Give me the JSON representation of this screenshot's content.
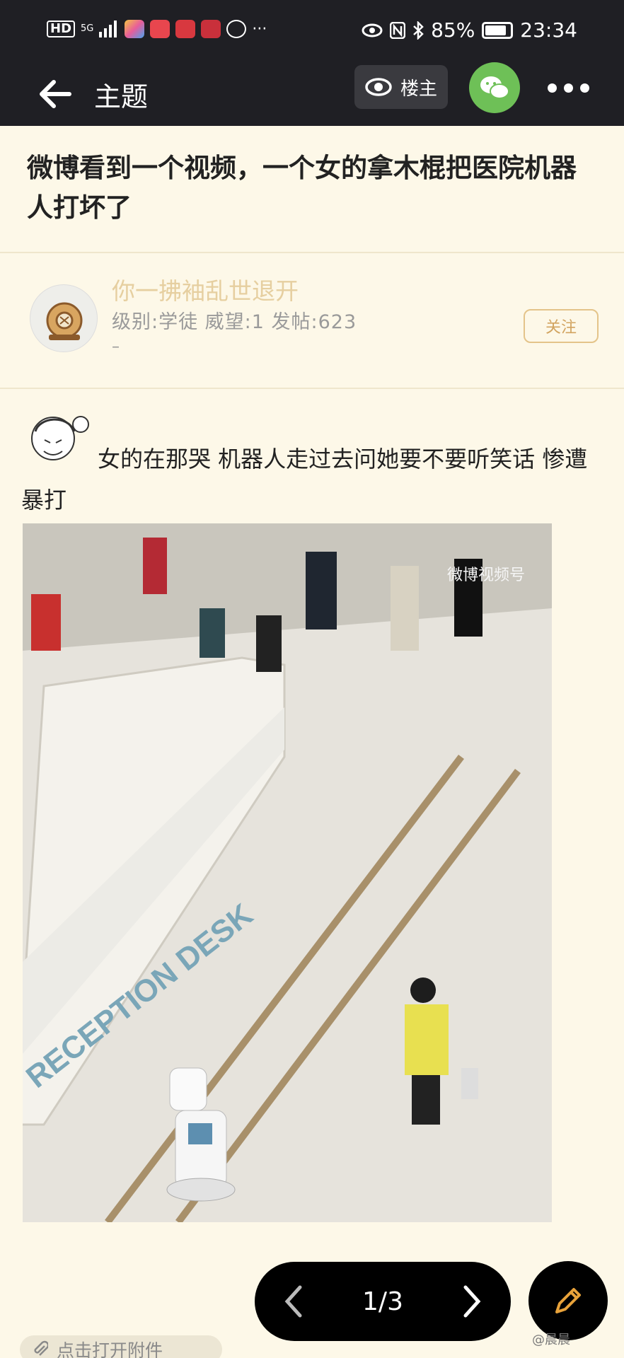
{
  "status_bar": {
    "hd": "HD",
    "network": "5G",
    "battery": "85%",
    "battery_level": 0.85,
    "time": "23:34",
    "dots": "···"
  },
  "nav": {
    "title": "主题",
    "owner_only": "楼主"
  },
  "post": {
    "title": "微博看到一个视频，一个女的拿木棍把医院机器人打坏了"
  },
  "author": {
    "name": "你一拂袖乱世退开",
    "meta": "级别:学徒 威望:1 发帖:623",
    "dash": "–",
    "follow_label": "关注"
  },
  "content": {
    "text": "女的在那哭 机器人走过去问她要不要听笑话 惨遭暴打",
    "image": {
      "desk_text": "RECEPTION DESK",
      "source": "微博视频号"
    }
  },
  "pager": {
    "current": "1/3"
  },
  "attachment": {
    "label": "点击打开附件"
  },
  "watermark": "@晨晨"
}
